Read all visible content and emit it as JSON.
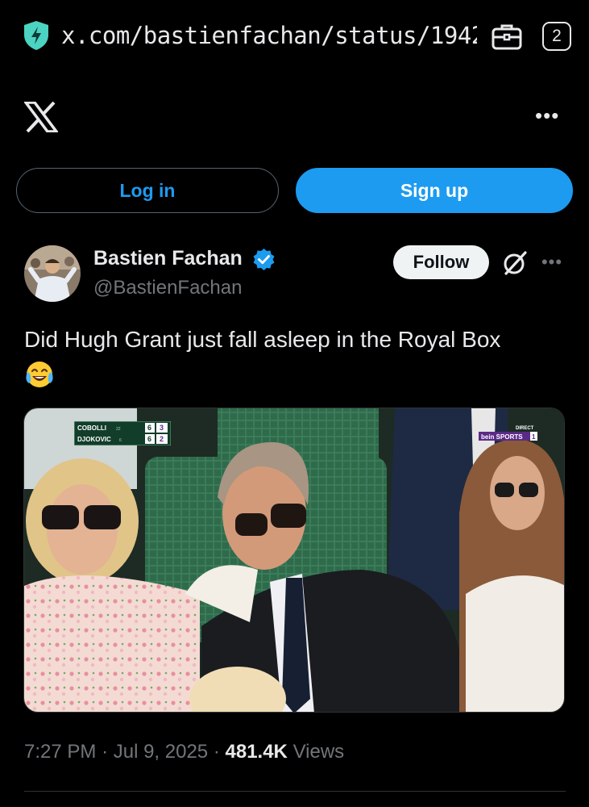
{
  "browser": {
    "url": "x.com/bastienfachan/status/1942",
    "tab_count": "2",
    "shield_icon": "shield-bolt-icon",
    "tab_icon": "briefcase-icon"
  },
  "header": {
    "logo_icon": "x-logo-icon",
    "more_label": "•••"
  },
  "auth": {
    "login_label": "Log in",
    "signup_label": "Sign up"
  },
  "post": {
    "author_name": "Bastien Fachan",
    "handle": "@BastienFachan",
    "follow_label": "Follow",
    "more_label": "•••",
    "text": "Did Hugh Grant just fall asleep in the Royal Box",
    "emoji": "😂",
    "time": "7:27 PM",
    "date": "Jul 9, 2025",
    "views_count": "481.4K",
    "views_label": "Views",
    "separator": "·"
  },
  "media": {
    "scoreboard": {
      "player1": "COBOLLI",
      "player1_seed": "22",
      "player2": "DJOKOVIC",
      "player2_seed": "6",
      "p1_set1": "6",
      "p1_set2": "3",
      "p2_set1": "6",
      "p2_set2": "2"
    },
    "broadcaster": "bein SPORTS",
    "broadcaster_channel": "1",
    "broadcaster_tag": "DIRECT"
  },
  "colors": {
    "accent": "#1d9bf0",
    "background": "#000000",
    "muted": "#71767b",
    "text": "#e7e9ea"
  }
}
